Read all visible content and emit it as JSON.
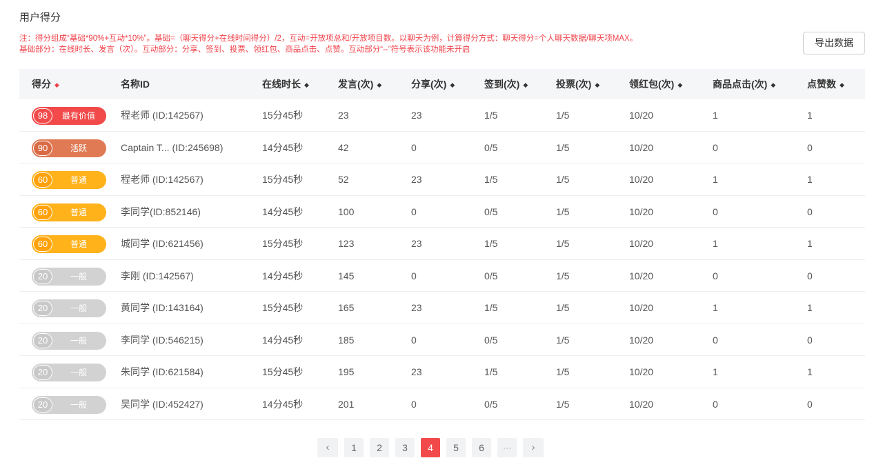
{
  "page": {
    "title": "用户得分",
    "note_line1": "注：得分组成“基础*90%+互动*10%”。基础=（聊天得分+在线时间得分）/2，互动=开放项总和/开放项目数。以聊天为例，计算得分方式：聊天得分=个人聊天数据/聊天项MAX。",
    "note_line2": "基础部分：在线时长、发言（次）。互动部分：分享、签到、投票、领红包、商品点击、点赞。互动部分“--”符号表示该功能未开启",
    "export_label": "导出数据"
  },
  "table": {
    "columns": [
      {
        "key": "score",
        "label": "得分",
        "sortable": true
      },
      {
        "key": "name",
        "label": "名称ID",
        "sortable": false
      },
      {
        "key": "online",
        "label": "在线时长",
        "sortable": true
      },
      {
        "key": "speak",
        "label": "发言(次)",
        "sortable": true
      },
      {
        "key": "share",
        "label": "分享(次)",
        "sortable": true
      },
      {
        "key": "signin",
        "label": "签到(次)",
        "sortable": true
      },
      {
        "key": "vote",
        "label": "投票(次)",
        "sortable": true
      },
      {
        "key": "redpack",
        "label": "领红包(次)",
        "sortable": true
      },
      {
        "key": "click",
        "label": "商品点击(次)",
        "sortable": true
      },
      {
        "key": "like",
        "label": "点赞数",
        "sortable": true
      }
    ],
    "rows": [
      {
        "score": "98",
        "badge": "最有价值",
        "badge_color": "#f24a4a",
        "name": "程老师 (ID:142567)",
        "online": "15分45秒",
        "speak": "23",
        "share": "23",
        "signin": "1/5",
        "vote": "1/5",
        "redpack": "10/20",
        "click": "1",
        "like": "1"
      },
      {
        "score": "90",
        "badge": "活跃",
        "badge_color": "#e07a55",
        "name": "Captain T... (ID:245698)",
        "online": "14分45秒",
        "speak": "42",
        "share": "0",
        "signin": "0/5",
        "vote": "1/5",
        "redpack": "10/20",
        "click": "0",
        "like": "0"
      },
      {
        "score": "60",
        "badge": "普通",
        "badge_color": "#ffb21a",
        "name": "程老师 (ID:142567)",
        "online": "15分45秒",
        "speak": "52",
        "share": "23",
        "signin": "1/5",
        "vote": "1/5",
        "redpack": "10/20",
        "click": "1",
        "like": "1"
      },
      {
        "score": "60",
        "badge": "普通",
        "badge_color": "#ffb21a",
        "name": "李同学(ID:852146)",
        "online": "14分45秒",
        "speak": "100",
        "share": "0",
        "signin": "0/5",
        "vote": "1/5",
        "redpack": "10/20",
        "click": "0",
        "like": "0"
      },
      {
        "score": "60",
        "badge": "普通",
        "badge_color": "#ffb21a",
        "name": "城同学 (ID:621456)",
        "online": "15分45秒",
        "speak": "123",
        "share": "23",
        "signin": "1/5",
        "vote": "1/5",
        "redpack": "10/20",
        "click": "1",
        "like": "1"
      },
      {
        "score": "20",
        "badge": "一般",
        "badge_color": "#d2d2d2",
        "name": "李刚 (ID:142567)",
        "online": "14分45秒",
        "speak": "145",
        "share": "0",
        "signin": "0/5",
        "vote": "1/5",
        "redpack": "10/20",
        "click": "0",
        "like": "0"
      },
      {
        "score": "20",
        "badge": "一般",
        "badge_color": "#d2d2d2",
        "name": "黄同学 (ID:143164)",
        "online": "15分45秒",
        "speak": "165",
        "share": "23",
        "signin": "1/5",
        "vote": "1/5",
        "redpack": "10/20",
        "click": "1",
        "like": "1"
      },
      {
        "score": "20",
        "badge": "一般",
        "badge_color": "#d2d2d2",
        "name": "李同学 (ID:546215)",
        "online": "14分45秒",
        "speak": "185",
        "share": "0",
        "signin": "0/5",
        "vote": "1/5",
        "redpack": "10/20",
        "click": "0",
        "like": "0"
      },
      {
        "score": "20",
        "badge": "一般",
        "badge_color": "#d2d2d2",
        "name": "朱同学 (ID:621584)",
        "online": "15分45秒",
        "speak": "195",
        "share": "23",
        "signin": "1/5",
        "vote": "1/5",
        "redpack": "10/20",
        "click": "1",
        "like": "1"
      },
      {
        "score": "20",
        "badge": "一般",
        "badge_color": "#d2d2d2",
        "name": "吴同学 (ID:452427)",
        "online": "14分45秒",
        "speak": "201",
        "share": "0",
        "signin": "0/5",
        "vote": "1/5",
        "redpack": "10/20",
        "click": "0",
        "like": "0"
      }
    ]
  },
  "pagination": {
    "prev_icon": "chevron-left-icon",
    "next_icon": "chevron-right-icon",
    "pages": [
      "1",
      "2",
      "3",
      "4",
      "5",
      "6"
    ],
    "current": "4",
    "ellipsis": "···"
  },
  "colors": {
    "accent": "#f24a4a",
    "note": "#f0424a",
    "header_bg": "#f5f6f8"
  }
}
